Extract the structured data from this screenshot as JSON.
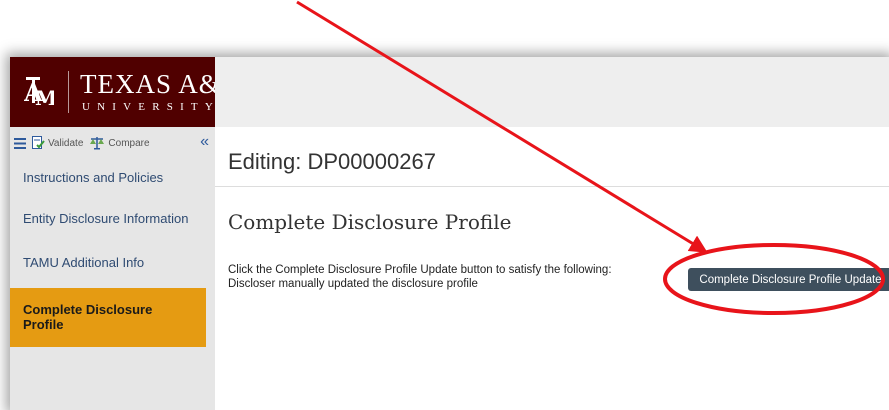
{
  "brand": {
    "monogram": "ĀTM",
    "name": "TEXAS A&M",
    "sub": "UNIVERSITY",
    "color": "#500000"
  },
  "toolbar": {
    "validate_label": "Validate",
    "compare_label": "Compare"
  },
  "sidebar": {
    "items": [
      {
        "label": "Instructions and Policies"
      },
      {
        "label": "Entity Disclosure Information"
      },
      {
        "label": "TAMU Additional Info"
      },
      {
        "label": "Complete Disclosure Profile",
        "active": true
      }
    ],
    "active_color": "#e59b12"
  },
  "main": {
    "page_title": "Editing: DP00000267",
    "section_title": "Complete Disclosure Profile",
    "info_line1": "Click the Complete Disclosure Profile Update button to satisfy the following:",
    "info_line2": "Discloser manually updated the disclosure profile",
    "button_label": "Complete Disclosure Profile Update",
    "button_color": "#3e4f5d"
  },
  "annotation": {
    "color": "#e8141a"
  },
  "icons": [
    "menu-icon",
    "validate-icon",
    "compare-icon",
    "collapse-icon"
  ]
}
